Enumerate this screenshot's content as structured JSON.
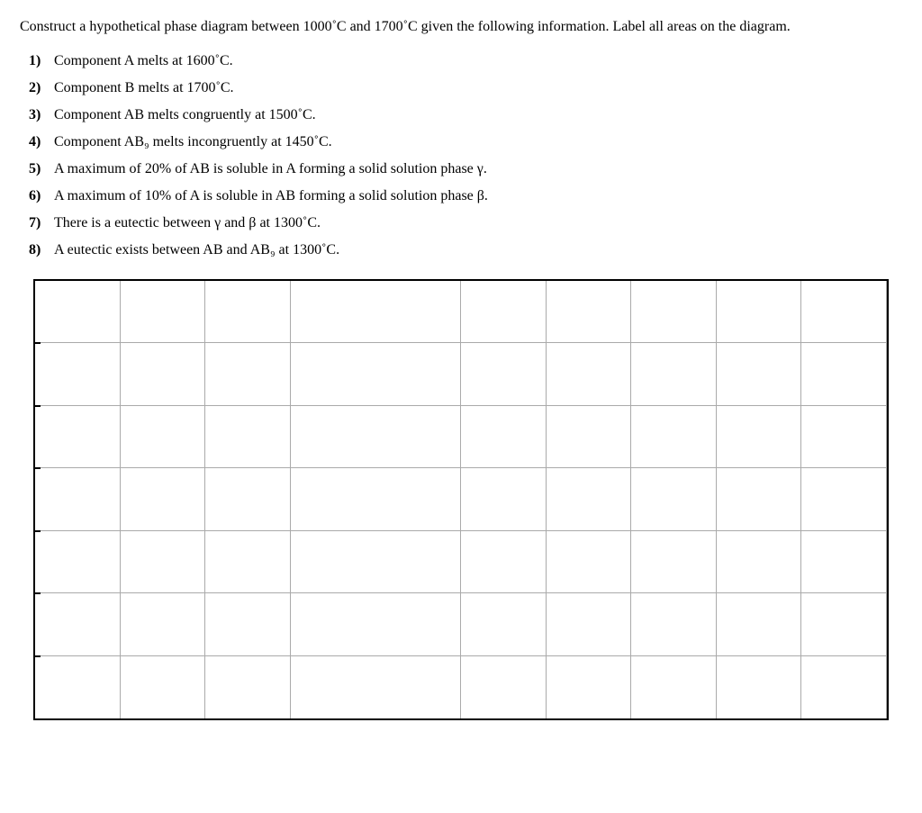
{
  "intro": {
    "text": "Construct a hypothetical phase diagram between 1000˚C and 1700˚C given the following information. Label all areas on the diagram."
  },
  "items": [
    {
      "number": "1)",
      "text": "Component A melts at 1600˚C."
    },
    {
      "number": "2)",
      "text": "Component B melts at 1700˚C."
    },
    {
      "number": "3)",
      "text": "Component AB melts congruently at 1500˚C."
    },
    {
      "number": "4)",
      "text": "Component AB₉ melts incongruently at 1450˚C."
    },
    {
      "number": "5)",
      "text": "A maximum of 20% of AB is soluble in A forming a solid solution phase γ."
    },
    {
      "number": "6)",
      "text": "A maximum of 10% of A is soluble in AB forming a solid solution phase β."
    },
    {
      "number": "7)",
      "text": "There is a eutectic between γ and β at 1300˚C."
    },
    {
      "number": "8)",
      "text": "A eutectic exists between AB and AB₉ at 1300˚C."
    }
  ],
  "grid": {
    "cols": 10,
    "rows": 7
  }
}
